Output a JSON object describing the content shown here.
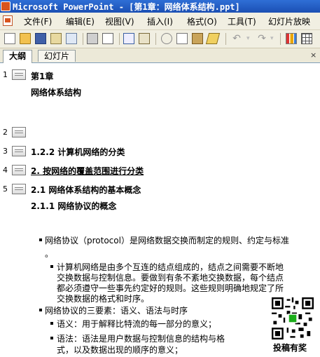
{
  "window": {
    "title": "Microsoft PowerPoint - [第1章：网络体系结构.ppt]"
  },
  "menu": {
    "items": [
      {
        "label": "文件(F)"
      },
      {
        "label": "编辑(E)"
      },
      {
        "label": "视图(V)"
      },
      {
        "label": "插入(I)"
      },
      {
        "label": "格式(O)"
      },
      {
        "label": "工具(T)"
      },
      {
        "label": "幻灯片放映"
      }
    ]
  },
  "toolbar": {
    "icons": [
      "new-icon",
      "open-icon",
      "save-icon",
      "permission-icon",
      "email-icon",
      "print-icon",
      "print-preview-icon",
      "spelling-icon",
      "research-icon",
      "cut-icon",
      "copy-icon",
      "paste-icon",
      "format-painter-icon",
      "undo-icon",
      "redo-icon",
      "insert-chart-icon",
      "insert-table-icon"
    ]
  },
  "tabs": [
    {
      "label": "大纲",
      "active": true
    },
    {
      "label": "幻灯片",
      "active": false
    }
  ],
  "outline": {
    "slides": [
      {
        "number": "1",
        "title": "第1章",
        "subtitle": "网络体系结构"
      },
      {
        "number": "2",
        "title": ""
      },
      {
        "number": "3",
        "title": "1.2.2 计算机网络的分类"
      },
      {
        "number": "4",
        "title": "2. 按网络的覆盖范围进行分类"
      },
      {
        "number": "5",
        "title": "2.1  网络体系结构的基本概念",
        "subtitle": "2.1.1  网络协议的概念"
      }
    ],
    "body": [
      "网络协议（protocol）是网络数据交换而制定的规则、约定与标准",
      "。",
      "计算机网络是由多个互连的结点组成的，结点之间需要不断地",
      "交换数据与控制信息。要做到有条不紊地交换数据，每个结点",
      "都必须遵守一些事先约定好的规则。这些规则明确地规定了所",
      "交换数据的格式和时序。",
      "网络协议的三要素：语义、语法与时序",
      "语义：用于解释比特流的每一部分的意义；",
      "语法：语法是用户数据与控制信息的结构与格",
      "式，以及数据出现的顺序的意义；"
    ]
  },
  "watermark": {
    "label": "投稿有奖"
  }
}
